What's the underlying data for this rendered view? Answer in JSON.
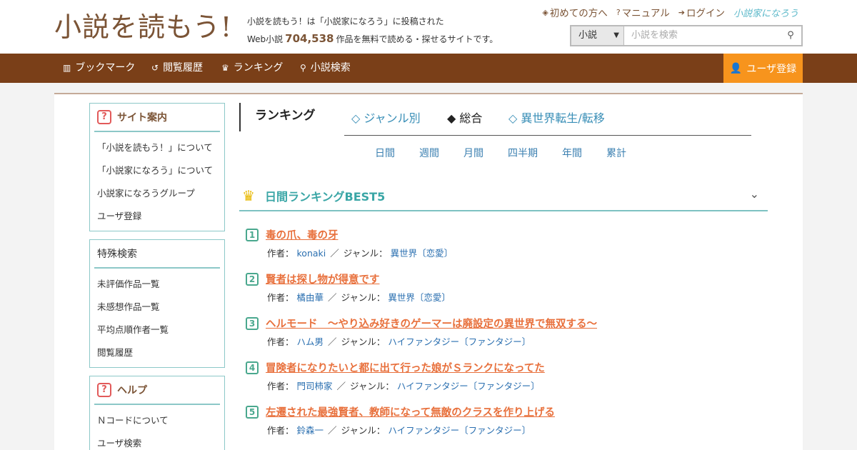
{
  "header": {
    "logo": "小説を読もう!",
    "tagline_line1": "小説を読もう！は「小説家になろう」に投稿された",
    "tagline_prefix": "Web小説",
    "work_count": "704,538",
    "tagline_suffix": "作品を無料で読める・探せるサイトです。",
    "links": {
      "first_time": "初めての方へ",
      "manual": "マニュアル",
      "login": "ログイン",
      "narou": "小説家になろう"
    },
    "search": {
      "category": "小説",
      "placeholder": "小説を検索"
    }
  },
  "nav": {
    "bookmark": "ブックマーク",
    "history": "閲覧履歴",
    "ranking": "ランキング",
    "search": "小説検索",
    "register": "ユーザ登録"
  },
  "sidebar": {
    "guide": {
      "title": "サイト案内",
      "items": [
        "「小説を読もう！」について",
        "「小説家になろう」について",
        "小説家になろうグループ",
        "ユーザ登録"
      ]
    },
    "special": {
      "title": "特殊検索",
      "items": [
        "未評価作品一覧",
        "未感想作品一覧",
        "平均点順作者一覧",
        "閲覧履歴"
      ]
    },
    "help": {
      "title": "ヘルプ",
      "items": [
        "Ｎコードについて",
        "ユーザ検索"
      ]
    }
  },
  "ranking": {
    "title": "ランキング",
    "tabs": [
      {
        "label": "◇ ジャンル別",
        "active": false
      },
      {
        "label": "◆ 総合",
        "active": true
      },
      {
        "label": "◇ 異世界転生/転移",
        "active": false
      }
    ],
    "periods": [
      "日間",
      "週間",
      "月間",
      "四半期",
      "年間",
      "累計"
    ],
    "best_title": "日間ランキングBEST5",
    "author_label": "作者：",
    "genre_label": "ジャンル：",
    "entries": [
      {
        "rank": "1",
        "title": "毒の爪、毒の牙",
        "author": "konaki",
        "genre": "異世界〔恋愛〕"
      },
      {
        "rank": "2",
        "title": "賢者は探し物が得意です",
        "author": "橘由華",
        "genre": "異世界〔恋愛〕"
      },
      {
        "rank": "3",
        "title": "ヘルモード　～やり込み好きのゲーマーは廃設定の異世界で無双する～",
        "author": "ハム男",
        "genre": "ハイファンタジー〔ファンタジー〕"
      },
      {
        "rank": "4",
        "title": "冒険者になりたいと都に出て行った娘がＳランクになってた",
        "author": "門司柿家",
        "genre": "ハイファンタジー〔ファンタジー〕"
      },
      {
        "rank": "5",
        "title": "左遷された最強賢者、教師になって無敵のクラスを作り上げる",
        "author": "鈴森一",
        "genre": "ハイファンタジー〔ファンタジー〕"
      }
    ]
  }
}
